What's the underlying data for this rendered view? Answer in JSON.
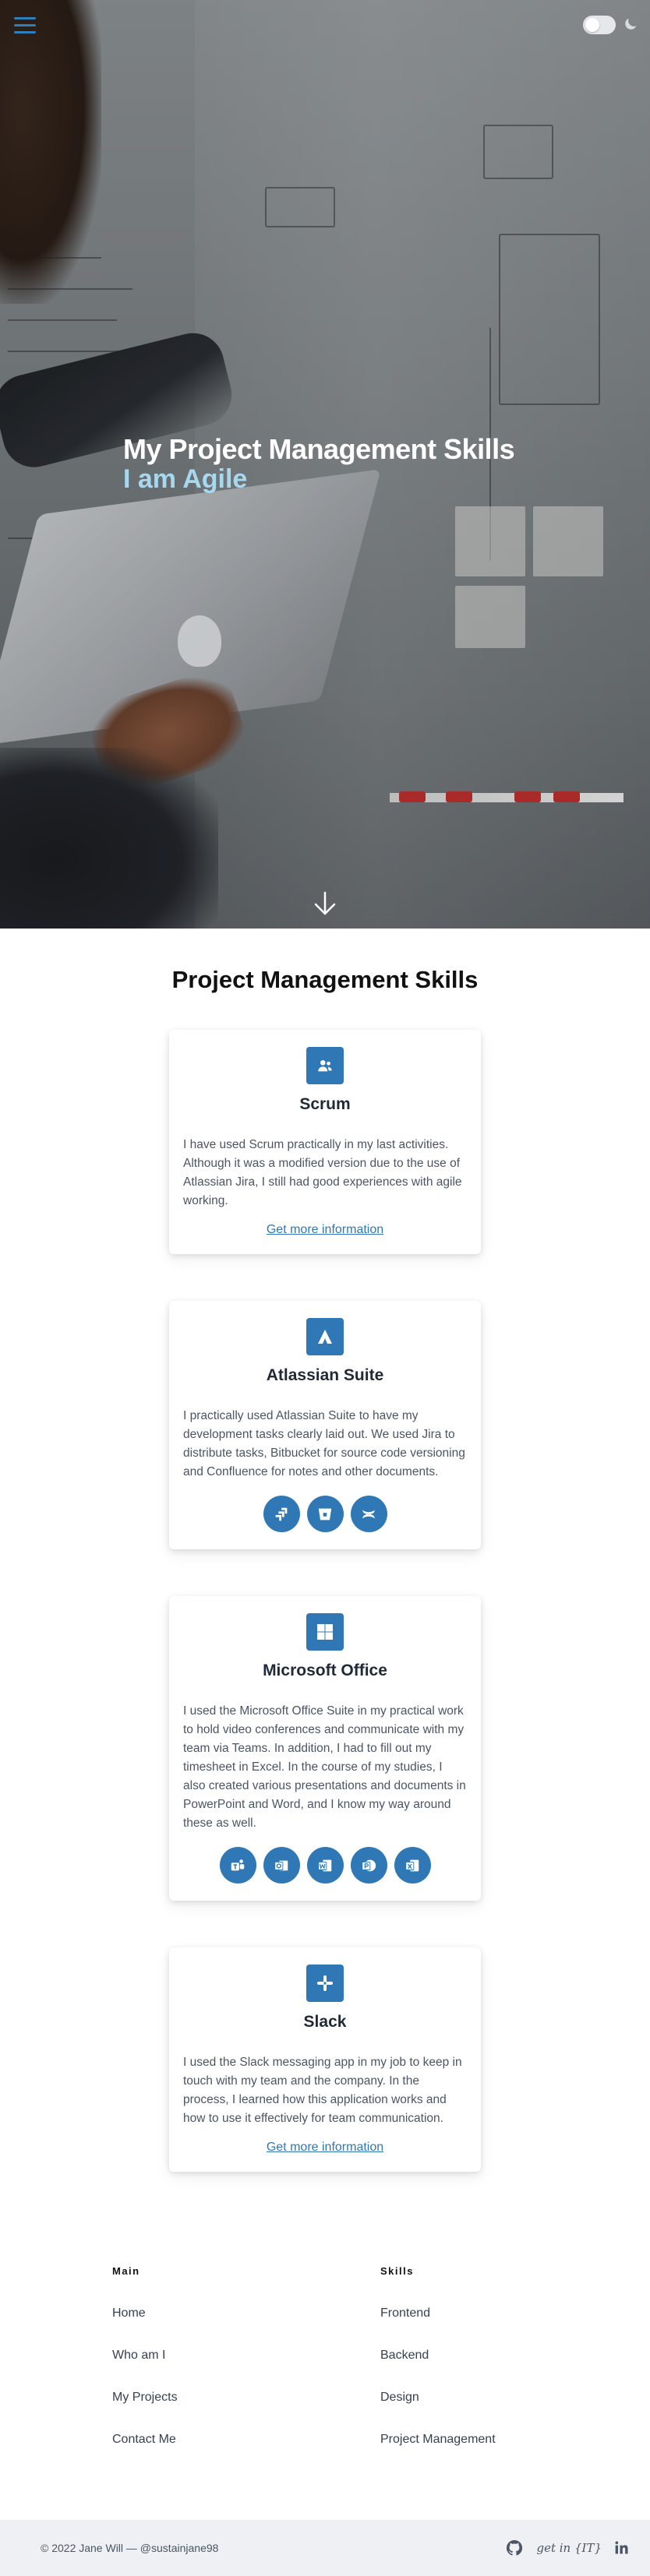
{
  "hero": {
    "title": "My Project Management Skills",
    "subtitle": "I am Agile"
  },
  "colors": {
    "accent": "#2f78b5",
    "subtitle": "#a8d8f0",
    "footer_bg": "#eef0f3"
  },
  "skills": {
    "title": "Project Management Skills",
    "cards": [
      {
        "icon": "users-icon",
        "title": "Scrum",
        "text": "I have used Scrum practically in my last activities. Although it was a modified version due to the use of Atlassian Jira, I still had good experiences with agile working.",
        "link": "Get more information"
      },
      {
        "icon": "atlassian-icon",
        "title": "Atlassian Suite",
        "text": "I practically used Atlassian Suite to have my development tasks clearly laid out. We used Jira to distribute tasks, Bitbucket for source code versioning and Confluence for notes and other documents.",
        "tools": [
          "jira-icon",
          "bitbucket-icon",
          "confluence-icon"
        ]
      },
      {
        "icon": "windows-icon",
        "title": "Microsoft Office",
        "text": "I used the Microsoft Office Suite in my practical work to hold video conferences and communicate with my team via Teams. In addition, I had to fill out my timesheet in Excel. In the course of my studies, I also created various presentations and documents in PowerPoint and Word, and I know my way around these as well.",
        "tools": [
          "teams-icon",
          "outlook-icon",
          "word-icon",
          "powerpoint-icon",
          "excel-icon"
        ]
      },
      {
        "icon": "slack-icon",
        "title": "Slack",
        "text": "I used the Slack messaging app in my job to keep in touch with my team and the company. In the process, I learned how this application works and how to use it effectively for team communication.",
        "link": "Get more information"
      }
    ]
  },
  "footer": {
    "main_heading": "Main",
    "main_links": [
      "Home",
      "Who am I",
      "My Projects",
      "Contact Me"
    ],
    "skills_heading": "Skills",
    "skills_links": [
      "Frontend",
      "Backend",
      "Design",
      "Project Management"
    ],
    "copyright": "© 2022 Jane Will — @sustainjane98",
    "getin_label": "get in {IT}"
  }
}
